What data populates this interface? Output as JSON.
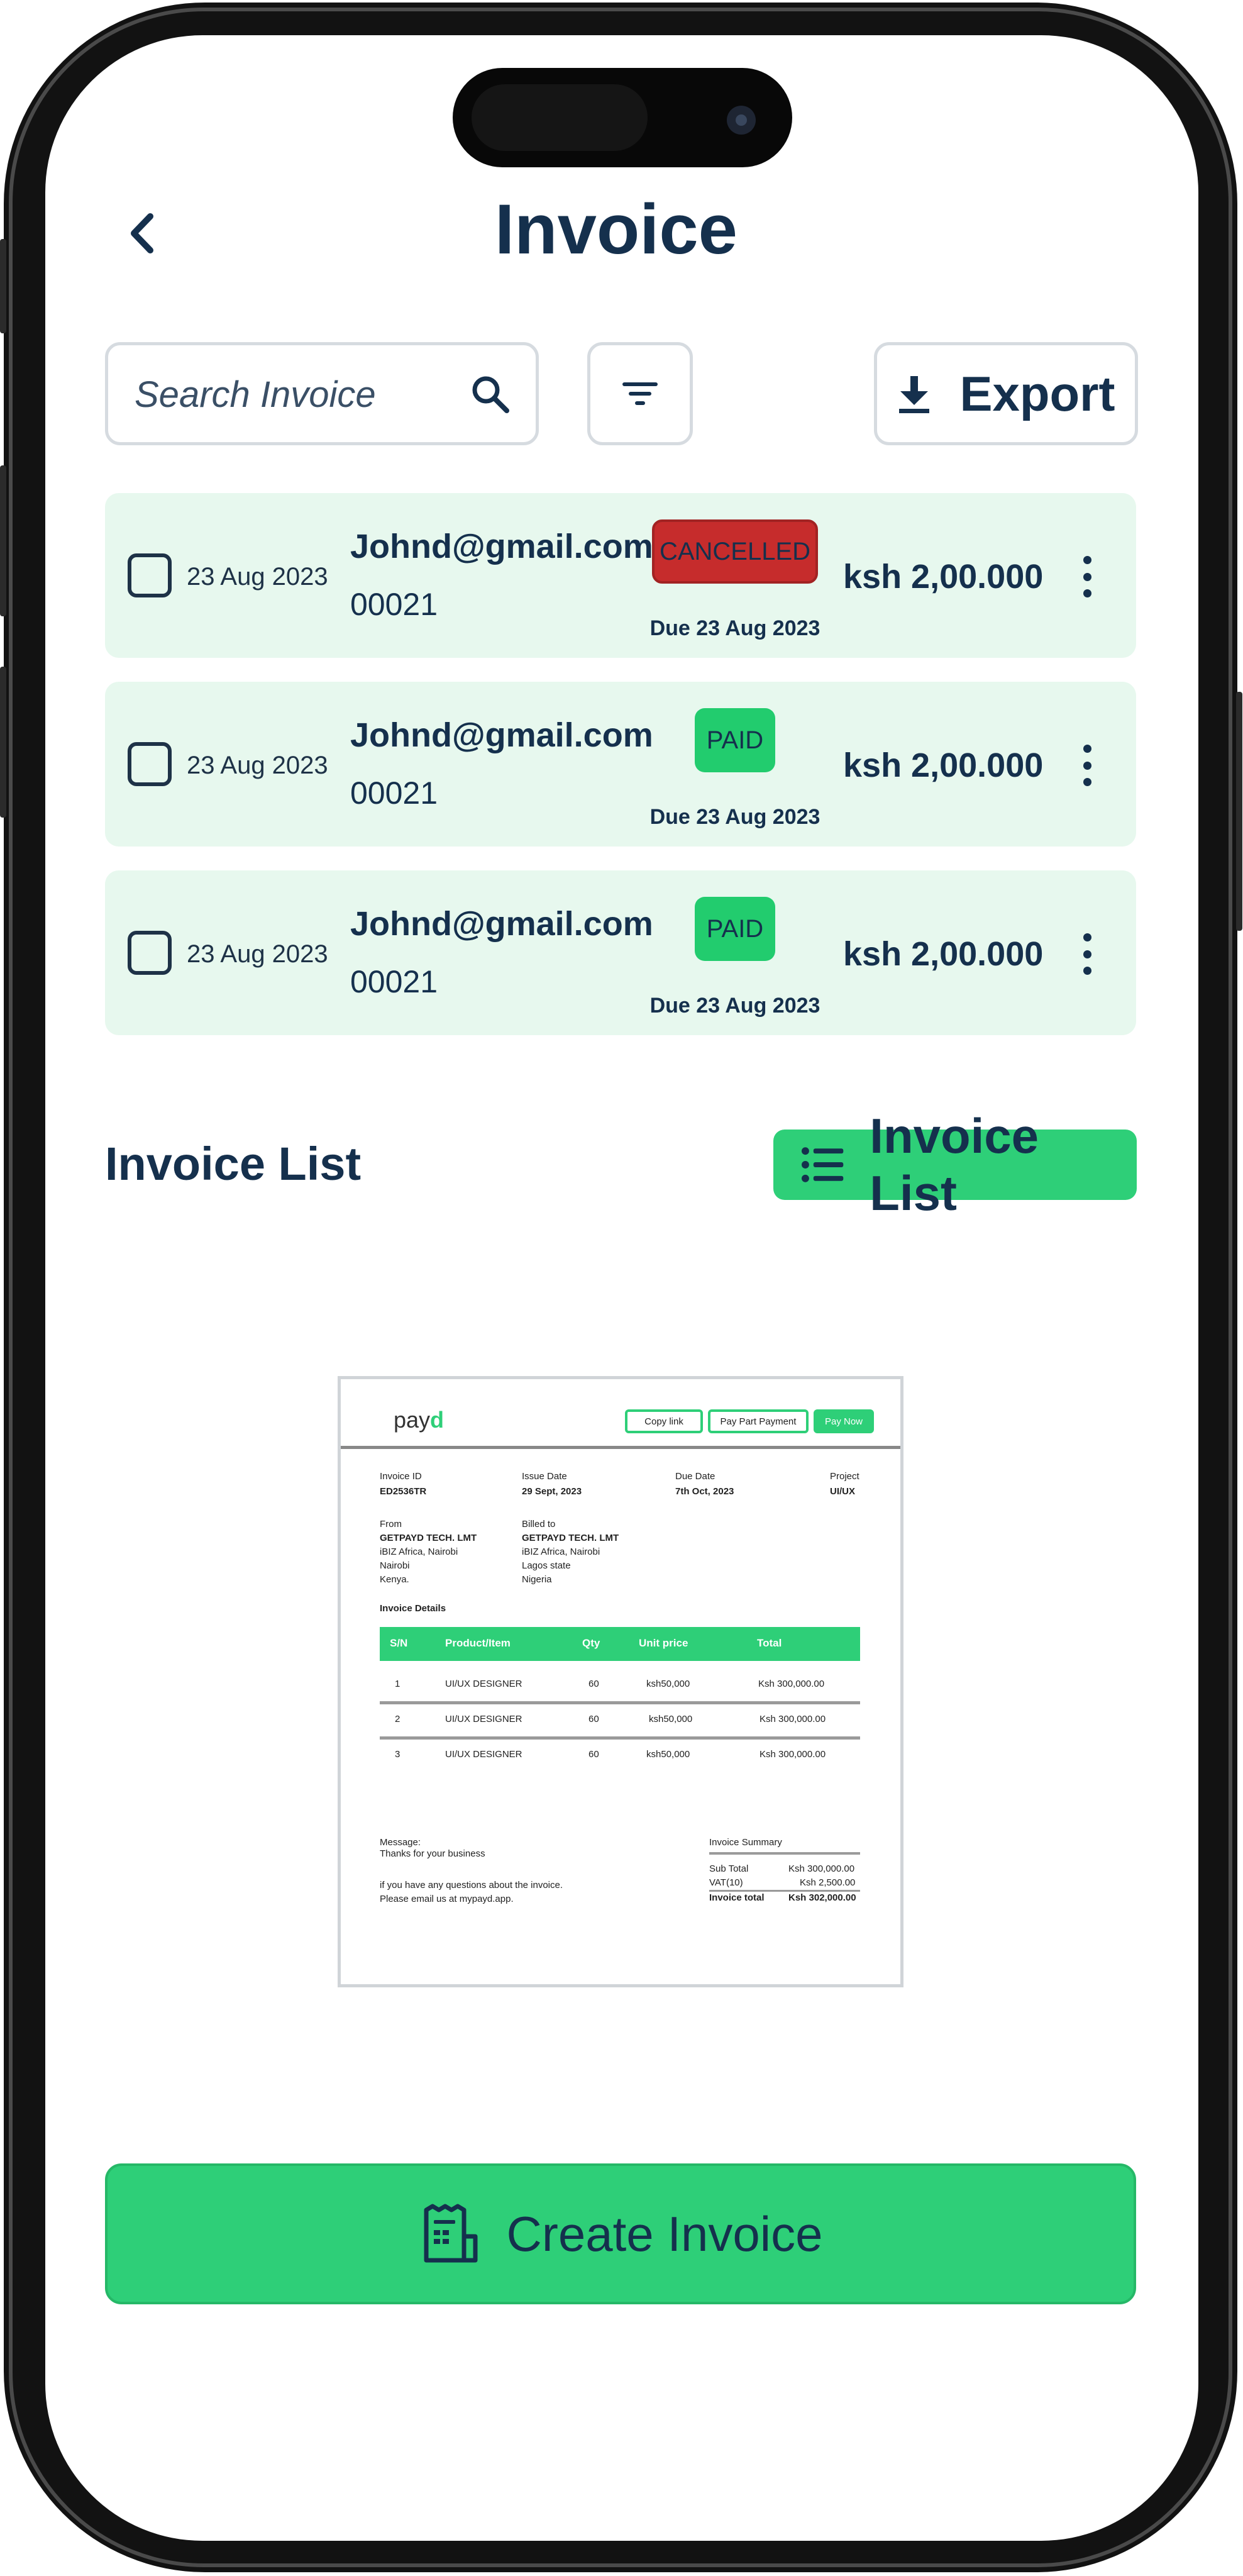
{
  "header": {
    "title": "Invoice",
    "back_icon": "chevron-left-icon"
  },
  "toolbar": {
    "search_placeholder": "Search Invoice",
    "search_icon": "search-icon",
    "filter_icon": "filter-icon",
    "export_label": "Export",
    "export_icon": "download-icon"
  },
  "invoices": [
    {
      "date": "23 Aug 2023",
      "email": "Johnd@gmail.com",
      "number": "00021",
      "status": "CANCELLED",
      "status_color": "#c62c2c",
      "due": "Due 23 Aug 2023",
      "amount": "ksh 2,00.000"
    },
    {
      "date": "23 Aug 2023",
      "email": "Johnd@gmail.com",
      "number": "00021",
      "status": "PAID",
      "status_color": "#22cc6e",
      "due": "Due 23 Aug 2023",
      "amount": "ksh 2,00.000"
    },
    {
      "date": "23 Aug 2023",
      "email": "Johnd@gmail.com",
      "number": "00021",
      "status": "PAID",
      "status_color": "#22cc6e",
      "due": "Due 23 Aug 2023",
      "amount": "ksh 2,00.000"
    }
  ],
  "invoice_list": {
    "title": "Invoice List",
    "button_label": "Invoice List",
    "button_icon": "list-icon"
  },
  "preview": {
    "logo": "payd",
    "buttons": {
      "copy_link": "Copy link",
      "pay_part": "Pay Part Payment",
      "pay_now": "Pay Now"
    },
    "meta": [
      {
        "label": "Invoice ID",
        "value": "ED2536TR"
      },
      {
        "label": "Issue Date",
        "value": "29 Sept, 2023"
      },
      {
        "label": "Due Date",
        "value": "7th Oct, 2023"
      },
      {
        "label": "Project",
        "value": "UI/UX"
      }
    ],
    "from": {
      "label": "From",
      "name": "GETPAYD TECH. LMT",
      "lines": [
        "iBIZ Africa, Nairobi",
        "Nairobi",
        "Kenya."
      ]
    },
    "billed_to": {
      "label": "Billed to",
      "name": "GETPAYD TECH. LMT",
      "lines": [
        "iBIZ Africa, Nairobi",
        "Lagos state",
        "Nigeria"
      ]
    },
    "details_title": "Invoice Details",
    "table_headers": [
      "S/N",
      "Product/Item",
      "Qty",
      "Unit price",
      "Total"
    ],
    "table_rows": [
      [
        "1",
        "UI/UX DESIGNER",
        "60",
        "ksh50,000",
        "Ksh 300,000.00"
      ],
      [
        "2",
        "UI/UX DESIGNER",
        "60",
        "ksh50,000",
        "Ksh 300,000.00"
      ],
      [
        "3",
        "UI/UX DESIGNER",
        "60",
        "ksh50,000",
        "Ksh 300,000.00"
      ]
    ],
    "message_label": "Message:",
    "message_lines": [
      "Thanks for your business",
      "if you have any questions about the invoice.",
      "Please email us at mypayd.app."
    ],
    "summary_title": "Invoice Summary",
    "summary": [
      {
        "label": "Sub Total",
        "value": "Ksh 300,000.00"
      },
      {
        "label": "VAT(10)",
        "value": "Ksh 2,500.00"
      },
      {
        "label": "Invoice total",
        "value": "Ksh 302,000.00"
      }
    ]
  },
  "create_button": {
    "label": "Create Invoice",
    "icon": "receipt-icon"
  },
  "colors": {
    "brand_green": "#2ecf78",
    "row_bg": "#e7f8ee",
    "text_dark": "#15304d",
    "cancel_red": "#c62c2c"
  }
}
